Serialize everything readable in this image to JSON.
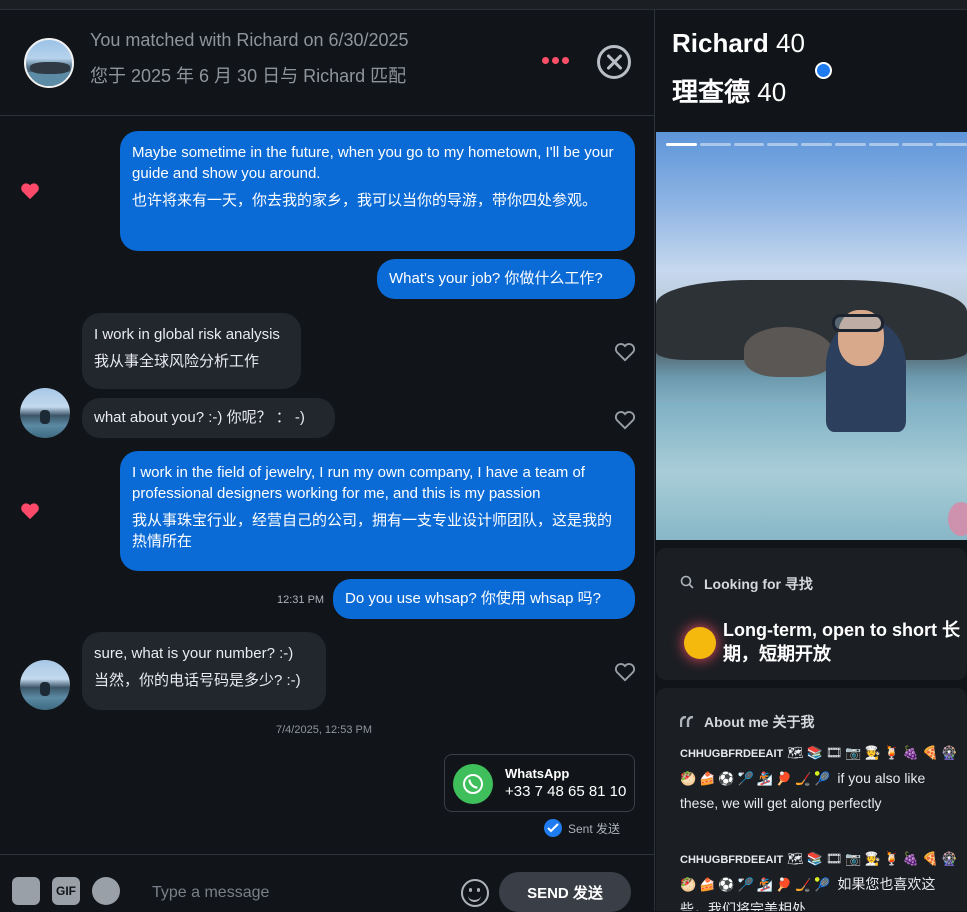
{
  "header": {
    "match_en": "You matched with Richard on 6/30/2025",
    "match_zh": "您于 2025 年 6 月 30 日与 Richard 匹配"
  },
  "messages": [
    {
      "dir": "out",
      "text": "Maybe sometime in the future, when you go to my hometown, I'll be your guide and show you around.",
      "translation": "也许将来有一天，你去我的家乡，我可以当你的导游，带你四处参观。",
      "liked": true
    },
    {
      "dir": "out",
      "text": "What's your job?",
      "translation": "你做什么工作?"
    },
    {
      "dir": "in",
      "text": "I work in global risk analysis",
      "translation": "我从事全球风险分析工作"
    },
    {
      "dir": "in",
      "text": "what about you? :-)",
      "translation": "你呢？ ： -)"
    },
    {
      "dir": "out",
      "text": "I work in the field of jewelry, I run my own company, I have a team of professional designers working for me, and this is my passion",
      "translation": "我从事珠宝行业，经营自己的公司，拥有一支专业设计师团队，这是我的热情所在",
      "liked": true
    },
    {
      "dir": "out",
      "text": "Do you use whsap?",
      "translation": "你使用 whsap 吗?",
      "time": "12:31 PM"
    },
    {
      "dir": "in",
      "text": "sure, what is your number? :-)",
      "translation": "当然，你的电话号码是多少? :-)"
    }
  ],
  "date_stamp": "7/4/2025, 12:53 PM",
  "whatsapp": {
    "title": "WhatsApp",
    "number": "+33 7 48 65 81 10"
  },
  "sent_status": "Sent  发送",
  "composer": {
    "gif_label": "GIF",
    "placeholder": "Type a message",
    "send_label": "SEND  发送"
  },
  "profile": {
    "name": "Richard",
    "age": "40",
    "name_zh": "理查德",
    "age_zh": "40",
    "looking_for_label": "Looking for  寻找",
    "looking_for_value": "Long-term, open to short  长期，短期开放",
    "about_label": "About me  关于我",
    "about_prefix": "CHHUGBFRDEEAIT",
    "about_en": "if you also like these, we will get along perfectly",
    "about_zh": "如果您也喜欢这些，我们将完美相处"
  },
  "colors": {
    "accent": "#fd5068",
    "bubble_out": "#0b6bd6",
    "bubble_in": "#22262d",
    "verified": "#1e7cf0",
    "whatsapp": "#3fbf5b"
  },
  "icons": [
    "options-dots-icon",
    "close-icon",
    "heart-icon",
    "whatsapp-icon",
    "sent-check-icon",
    "sticker-icon",
    "spotify-icon",
    "emoji-icon",
    "search-icon",
    "quote-icon",
    "verified-icon"
  ]
}
